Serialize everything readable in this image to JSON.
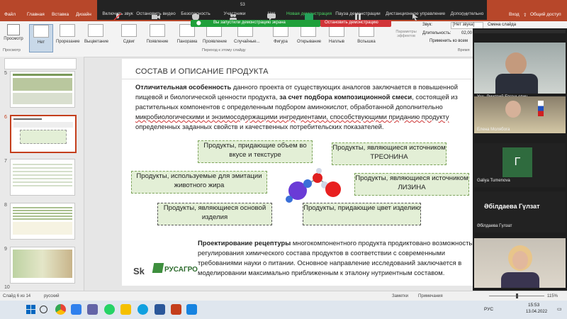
{
  "title_tabs": [
    "Файл",
    "Главная",
    "Вставка",
    "Дизайн"
  ],
  "title_right": {
    "signin": "Вход",
    "share": "Общий доступ"
  },
  "zoom": {
    "items": [
      "Включить звук",
      "Остановить видео",
      "Безопасность",
      "Участники",
      "Чат",
      "Новая демонстрация",
      "Пауза демонстрации",
      "Дистанционное управление",
      "Дополнительно"
    ],
    "participants_count": "53",
    "sharing_banner": "Вы запустили демонстрацию экрана",
    "stop_label": "Остановить демонстрацию"
  },
  "ribbon": {
    "preview": "Просмотр",
    "preview_group": "Просмотр",
    "transitions": [
      "Нет",
      "Прорезание",
      "Выцветание",
      "Сдвиг",
      "Появление",
      "Панорама",
      "Проявление",
      "Случайные...",
      "Фигура",
      "Открывание",
      "Наплыв",
      "Вспышка"
    ],
    "group_label": "Переход к этому слайду",
    "effects": "Параметры эффектов",
    "sound_label": "Звук:",
    "sound_value": "[Нет звука]",
    "duration_label": "Длительность:",
    "duration_value": "02,00",
    "apply_all": "Применить ко всем",
    "change_slide": "Смена слайда",
    "timing_group": "Время"
  },
  "slides": {
    "numbers": [
      "5",
      "6",
      "7",
      "8",
      "9",
      "10"
    ],
    "current": "6"
  },
  "slide": {
    "title": "СОСТАВ И ОПИСАНИЕ ПРОДУКТА",
    "para1_bold": "Отличительная особенность",
    "para1_a": " данного проекта от существующих аналогов заключается в повышенной",
    "para1_b": "пищевой и биологической ценности продукта, ",
    "para1_bold2": "за счет подбора композиционной смеси",
    "para1_c": ", состоящей из",
    "para1_d": "растительных компонентов с определенным подбором аминокислот, обработанной дополнительно",
    "para1_e": "микробиологическими и энзимосодержащими ингредиентами, способствующими приданию продукту",
    "para1_f": "определенных заданных свойств и качественных потребительских показателей.",
    "boxes": [
      "Продукты, придающие объем во вкусе и текстуре",
      "Продукты, являющиеся источником ТРЕОНИНА",
      "Продукты, используемые для эмитации животного жира",
      "Продукты, являющиеся источником ЛИЗИНА",
      "Продукты, являющиеся основой изделия",
      "Продукты, придающие цвет изделию"
    ],
    "para2_bold": "Проектирование рецептуры",
    "para2_a": " многокомпонентного продукта продиктовано возможностью",
    "para2_b": "регулирования химического состава продуктов в соответствии с современными",
    "para2_c": "требованиями науки о питании. Основное направление исследований заключается в",
    "para2_d": "моделировании максимально приближенным к эталону нутриентным составом.",
    "logo1": "Sk",
    "logo2": "РУСАГРО"
  },
  "video": [
    {
      "name": "Ушь Дмитрий Евгеньевич"
    },
    {
      "name": "Елена Молябога"
    },
    {
      "name": "Galiya Tumenova",
      "initial": "Г"
    },
    {
      "name": "Әбілдаева Гүлзат",
      "big": "Әбілдаева Гүлзат"
    },
    {
      "name": ""
    }
  ],
  "status": {
    "slide": "Слайд 6 из 14",
    "lang": "русский",
    "notes": "Заметки",
    "comments": "Примечания",
    "zoom": "115%"
  },
  "taskbar": {
    "lang": "РУС",
    "time": "15:53",
    "date": "13.04.2022"
  }
}
